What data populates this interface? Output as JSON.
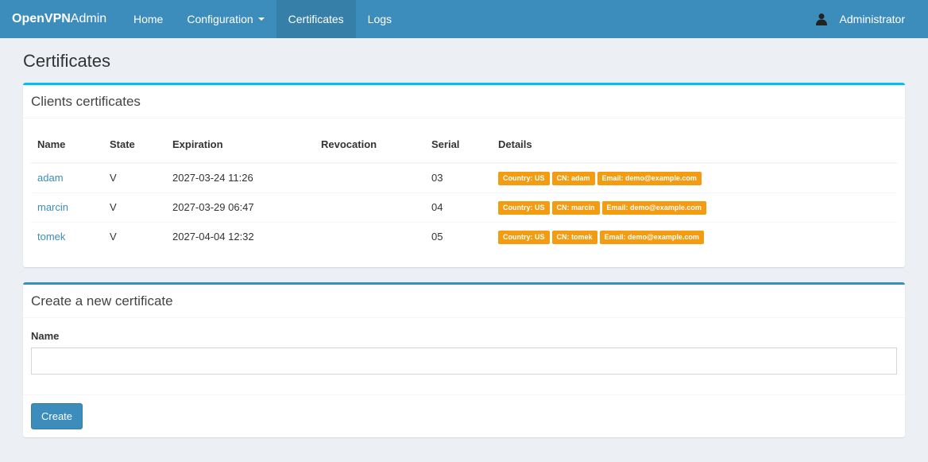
{
  "navbar": {
    "brand_bold": "OpenVPN",
    "brand_rest": "Admin",
    "items": [
      {
        "label": "Home"
      },
      {
        "label": "Configuration"
      },
      {
        "label": "Certificates"
      },
      {
        "label": "Logs"
      }
    ],
    "user": "Administrator",
    "color": "#3c8dbc"
  },
  "page": {
    "title": "Certificates"
  },
  "clients": {
    "title": "Clients certificates",
    "columns": [
      "Name",
      "State",
      "Expiration",
      "Revocation",
      "Serial",
      "Details"
    ],
    "rows": [
      {
        "name": "adam",
        "state": "V",
        "expiration": "2027-03-24 11:26",
        "revocation": "",
        "serial": "03",
        "details": [
          "Country: US",
          "CN: adam",
          "Email: demo@example.com"
        ]
      },
      {
        "name": "marcin",
        "state": "V",
        "expiration": "2027-03-29 06:47",
        "revocation": "",
        "serial": "04",
        "details": [
          "Country: US",
          "CN: marcin",
          "Email: demo@example.com"
        ]
      },
      {
        "name": "tomek",
        "state": "V",
        "expiration": "2027-04-04 12:32",
        "revocation": "",
        "serial": "05",
        "details": [
          "Country: US",
          "CN: tomek",
          "Email: demo@example.com"
        ]
      }
    ],
    "label_color": "#f39c12"
  },
  "create": {
    "title": "Create a new certificate",
    "name_label": "Name",
    "name_value": "",
    "name_placeholder": "",
    "button": "Create"
  }
}
